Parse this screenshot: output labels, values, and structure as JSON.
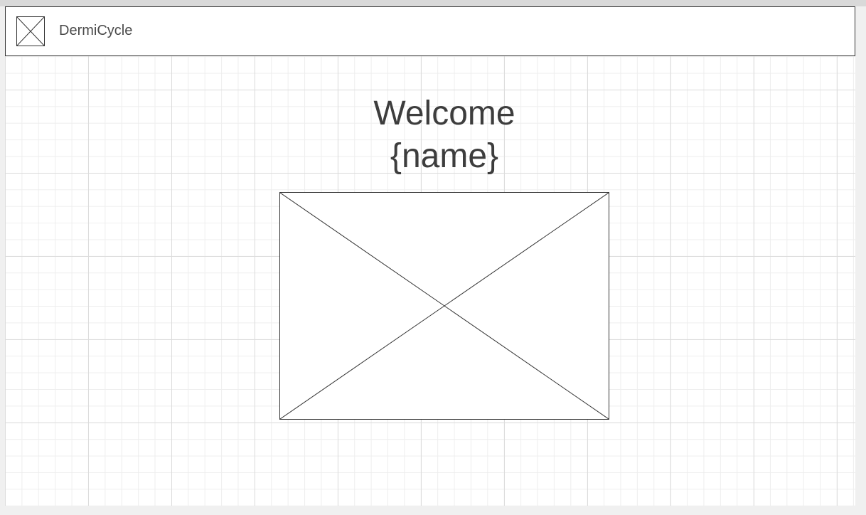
{
  "app": {
    "title": "DermiCycle"
  },
  "header": {
    "logo_icon": "image-placeholder-icon"
  },
  "main": {
    "welcome_line1": "Welcome",
    "welcome_line2": "{name}",
    "hero_image_icon": "image-placeholder-icon"
  },
  "colors": {
    "stroke": "#333333",
    "text": "#3d3d3d",
    "grid": "#dcdcdc",
    "background": "#ffffff"
  }
}
